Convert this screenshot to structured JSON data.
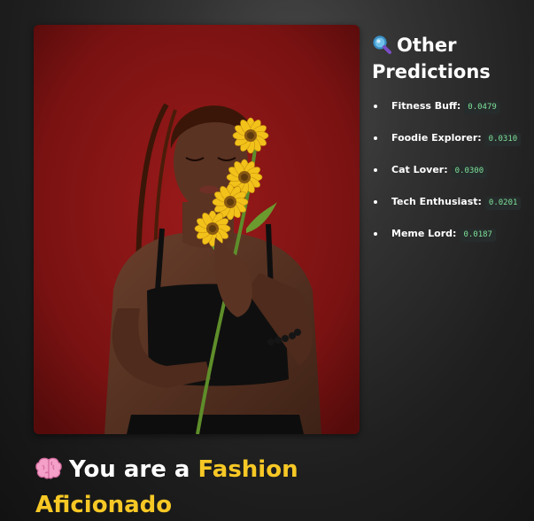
{
  "photo": {
    "icon_name": "portrait-photo-woman-with-sunflowers",
    "background_color": "#7a1212"
  },
  "side": {
    "icon": "magnifying-glass-icon",
    "title_line1": "Other",
    "title_line2": "Predictions",
    "predictions": [
      {
        "label": "Fitness Buff:",
        "score": "0.0479"
      },
      {
        "label": "Foodie Explorer:",
        "score": "0.0310"
      },
      {
        "label": "Cat Lover:",
        "score": "0.0300"
      },
      {
        "label": "Tech Enthusiast:",
        "score": "0.0201"
      },
      {
        "label": "Meme Lord:",
        "score": "0.0187"
      }
    ]
  },
  "result": {
    "icon": "brain-icon",
    "prefix": "You are a",
    "highlight_line1": "Fashion",
    "highlight_line2": "Aficionado"
  },
  "colors": {
    "highlight": "#f7c825",
    "score_text": "#7ee39a",
    "score_bg": "#262b2b"
  }
}
